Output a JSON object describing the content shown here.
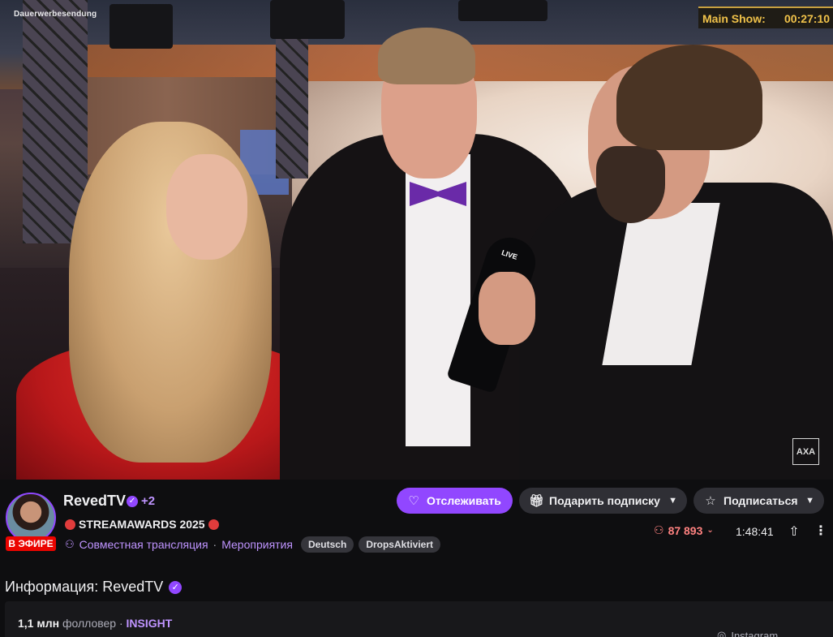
{
  "video": {
    "overlay_label": "Dauerwerbesendung",
    "main_show_label": "Main Show:",
    "main_show_time": "00:27:10",
    "mic_brand": "LIVE",
    "sponsor_logo": "AXA"
  },
  "channel": {
    "name": "RevedTV",
    "collaborators": "+2",
    "live_badge": "В ЭФИРЕ",
    "stream_title": "STREAMAWARDS 2025",
    "shared_stream": "Совместная трансляция",
    "category_separator": "·",
    "category": "Мероприятия",
    "tags": [
      "Deutsch",
      "DropsAktiviert"
    ]
  },
  "actions": {
    "follow": "Отслеживать",
    "gift_sub": "Подарить подписку",
    "subscribe": "Подписаться"
  },
  "stats": {
    "viewers": "87 893",
    "uptime": "1:48:41"
  },
  "about": {
    "title": "Информация: RevedTV",
    "followers_count": "1,1 млн",
    "followers_label": "фолловер",
    "separator": "·",
    "team": "INSIGHT",
    "instagram": "Instagram"
  },
  "icons": {
    "verified": "verified-badge-icon",
    "heart": "heart-icon",
    "gift": "gift-icon",
    "star": "star-icon",
    "chevron": "chevron-down-icon",
    "viewers": "viewers-icon",
    "share": "share-icon",
    "more": "more-vertical-icon"
  },
  "colors": {
    "accent": "#9147ff",
    "live": "#eb0400",
    "viewers": "#ff8280",
    "main_show": "#f0c24a"
  }
}
